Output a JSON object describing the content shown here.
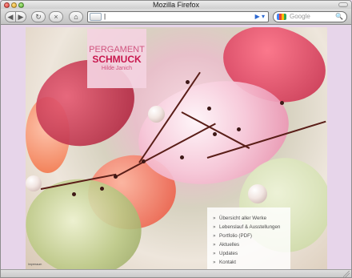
{
  "window": {
    "title": "Mozilla Firefox"
  },
  "toolbar": {
    "back": "◀",
    "forward": "▶",
    "reload": "↻",
    "stop": "×",
    "home": "⌂",
    "url_value": "|",
    "url_go": "▶ ▾",
    "search_placeholder": "Google",
    "search_icon": "🔍"
  },
  "site": {
    "logo": {
      "line1": "PERGAMENT",
      "line2": "SCHMUCK",
      "line3": "Hilde Janich"
    },
    "menu": [
      {
        "label": "Übersicht aller Werke"
      },
      {
        "label": "Lebenslauf & Ausstellungen"
      },
      {
        "label": "Portfolio (PDF)"
      },
      {
        "label": "Aktuelles"
      },
      {
        "label": "Updates"
      },
      {
        "label": "Kontakt"
      }
    ],
    "menu_arrow": "»",
    "credit": "Impressum"
  },
  "icons": {
    "back": "back-arrow-icon",
    "forward": "forward-arrow-icon",
    "reload": "reload-icon",
    "stop": "stop-icon",
    "home": "home-icon",
    "search": "search-icon"
  },
  "colors": {
    "page_background": "#e7d5ea",
    "logo_background": "#f4d2e1",
    "logo_text": "#c8174d",
    "menu_background": "#ffffff"
  }
}
